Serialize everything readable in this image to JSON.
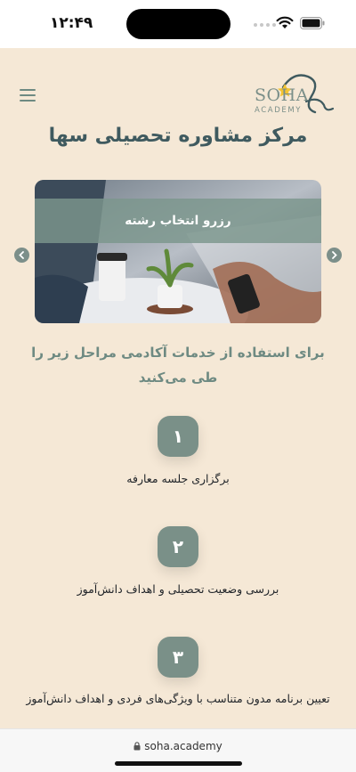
{
  "status_bar": {
    "time": "۱۲:۴۹"
  },
  "header": {
    "logo_text": "SOHA",
    "logo_sub": "ACADEMY",
    "title": "مرکز مشاوره تحصیلی سها"
  },
  "carousel": {
    "caption": "رزرو انتخاب رشته"
  },
  "intro": "برای استفاده از خدمات آکادمی مراحل زیر را طی می‌کنید",
  "steps": [
    {
      "number": "۱",
      "label": "برگزاری جلسه معارفه"
    },
    {
      "number": "۲",
      "label": "بررسی وضعیت تحصیلی و اهداف دانش‌آموز"
    },
    {
      "number": "۳",
      "label": "تعیین برنامه مدون متناسب با ویژگی‌های فردی و اهداف دانش‌آموز"
    }
  ],
  "browser": {
    "url": "soha.academy"
  },
  "colors": {
    "background": "#f5e8d6",
    "accent": "#7a9088",
    "title": "#3f5a5f"
  }
}
